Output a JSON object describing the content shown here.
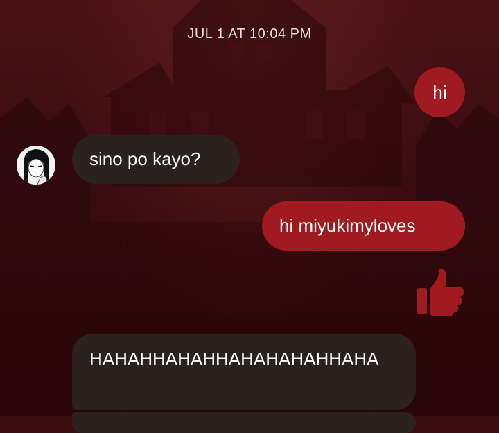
{
  "conversation": {
    "timestamp": "JUL 1 AT 10:04 PM",
    "messages": [
      {
        "from": "me",
        "text": "hi"
      },
      {
        "from": "them",
        "text": "sino po kayo?"
      },
      {
        "from": "me",
        "text": "hi miyukimyloves"
      },
      {
        "from": "me",
        "icon": "thumbs-up-icon"
      },
      {
        "from": "them",
        "text": "HAHAHHAHAHHAHAHAHAHHAHA"
      }
    ]
  },
  "colors": {
    "outgoing_bubble": "#a01b1f",
    "incoming_bubble": "#2b2220",
    "background": "#3a0c10",
    "thumbs_up": "#a01b1f"
  }
}
